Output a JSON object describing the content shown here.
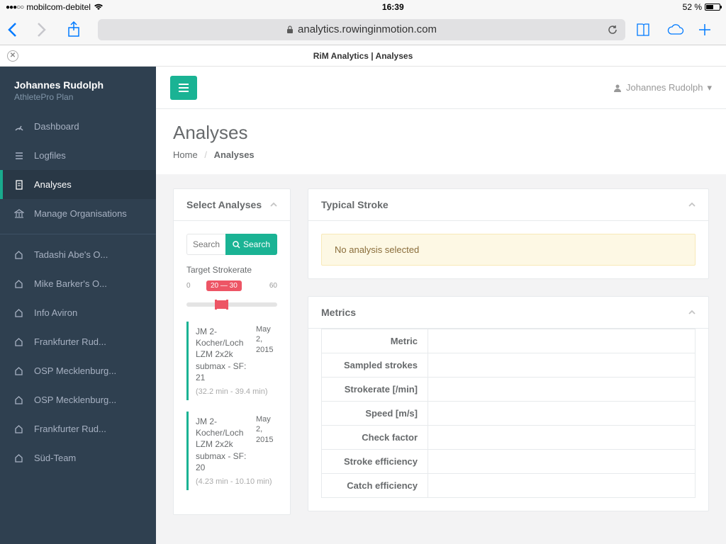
{
  "status": {
    "carrier": "mobilcom-debitel",
    "time": "16:39",
    "battery_pct": "52 %"
  },
  "safari": {
    "url_display": "analytics.rowinginmotion.com",
    "page_title": "RiM Analytics | Analyses"
  },
  "sidebar": {
    "user": "Johannes Rudolph",
    "plan": "AthletePro Plan",
    "nav": [
      {
        "label": "Dashboard",
        "icon": "gauge"
      },
      {
        "label": "Logfiles",
        "icon": "list"
      },
      {
        "label": "Analyses",
        "icon": "doc",
        "active": true
      },
      {
        "label": "Manage Organisations",
        "icon": "bank"
      }
    ],
    "orgs": [
      {
        "label": "Tadashi Abe's O..."
      },
      {
        "label": "Mike Barker's O..."
      },
      {
        "label": "Info Aviron"
      },
      {
        "label": "Frankfurter Rud..."
      },
      {
        "label": "OSP Mecklenburg..."
      },
      {
        "label": "OSP Mecklenburg..."
      },
      {
        "label": "Frankfurter Rud..."
      },
      {
        "label": "Süd-Team"
      }
    ]
  },
  "topbar": {
    "user": "Johannes Rudolph"
  },
  "page": {
    "heading": "Analyses",
    "breadcrumb_home": "Home",
    "breadcrumb_current": "Analyses"
  },
  "select_panel": {
    "title": "Select Analyses",
    "search_placeholder": "Search",
    "search_button": "Search",
    "strokerate_label": "Target Strokerate",
    "sr_min": "0",
    "sr_max": "60",
    "sr_badge": "20 — 30",
    "items": [
      {
        "title": "JM 2-Kocher/Loch LZM 2x2k submax - SF: 21",
        "date": "May 2, 2015",
        "sub": "(32.2 min - 39.4 min)"
      },
      {
        "title": "JM 2-Kocher/Loch LZM 2x2k submax - SF: 20",
        "date": "May 2, 2015",
        "sub": "(4.23 min - 10.10 min)"
      }
    ]
  },
  "typical_panel": {
    "title": "Typical Stroke",
    "alert": "No analysis selected"
  },
  "metrics_panel": {
    "title": "Metrics",
    "rows": [
      "Metric",
      "Sampled strokes",
      "Strokerate [/min]",
      "Speed [m/s]",
      "Check factor",
      "Stroke efficiency",
      "Catch efficiency"
    ]
  }
}
